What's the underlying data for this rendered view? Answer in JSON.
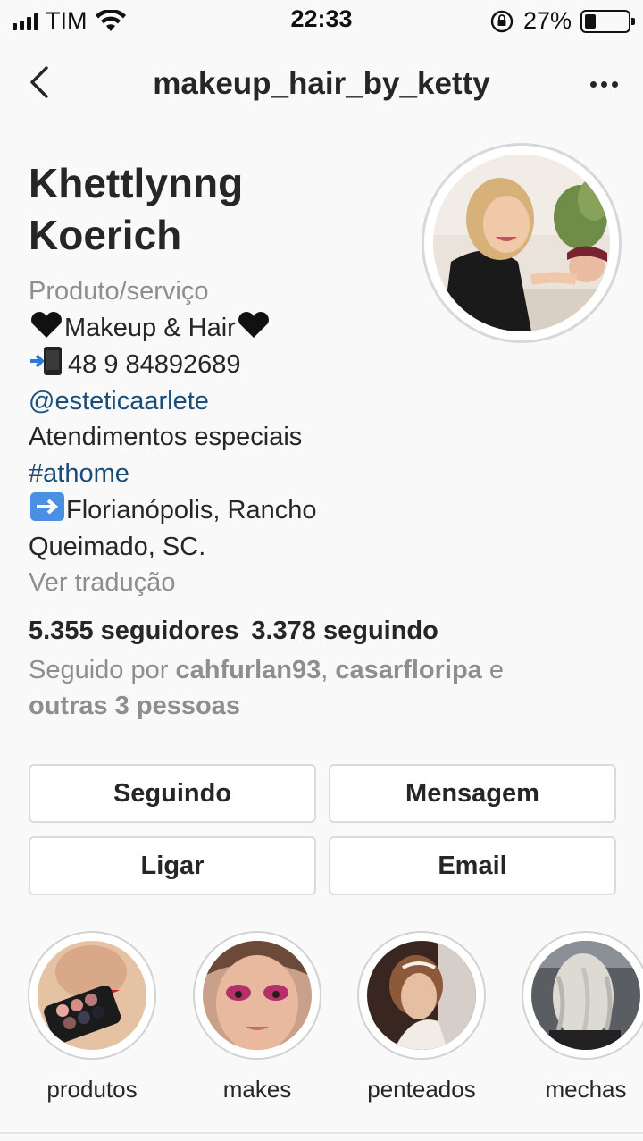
{
  "status_bar": {
    "carrier": "TIM",
    "time": "22:33",
    "battery_percent": "27%",
    "battery_level": 0.27
  },
  "nav": {
    "title": "makeup_hair_by_ketty"
  },
  "profile": {
    "name_line1": "Khettlynng",
    "name_line2": "Koerich",
    "category": "Produto/serviço",
    "bio_line1": "Makeup & Hair",
    "phone": "48 9 84892689",
    "mention": "@esteticaarlete",
    "bio_line4": "Atendimentos especiais",
    "hashtag": "#athome",
    "location_line1": "Florianópolis, Rancho",
    "location_line2": "Queimado, SC.",
    "translate": "Ver tradução"
  },
  "stats": {
    "followers": "5.355 seguidores",
    "following": "3.378 seguindo"
  },
  "followed_by": {
    "prefix": "Seguido por ",
    "user1": "cahfurlan93",
    "sep": ", ",
    "user2": "casarfloripa",
    "joiner": " e",
    "others": "outras 3 pessoas"
  },
  "buttons": {
    "following": "Seguindo",
    "message": "Mensagem",
    "call": "Ligar",
    "email": "Email"
  },
  "highlights": [
    {
      "label": "produtos"
    },
    {
      "label": "makes"
    },
    {
      "label": "penteados"
    },
    {
      "label": "mechas"
    }
  ],
  "icons": {
    "back": "chevron-left-icon",
    "more": "more-horizontal-icon",
    "heart": "black-heart-emoji",
    "phone": "mobile-phone-arrow-emoji",
    "arrow": "right-arrow-emoji"
  },
  "colors": {
    "link": "#1b4d7a",
    "muted": "#8e8e8e",
    "text": "#262626",
    "border": "#dbdbdb"
  }
}
